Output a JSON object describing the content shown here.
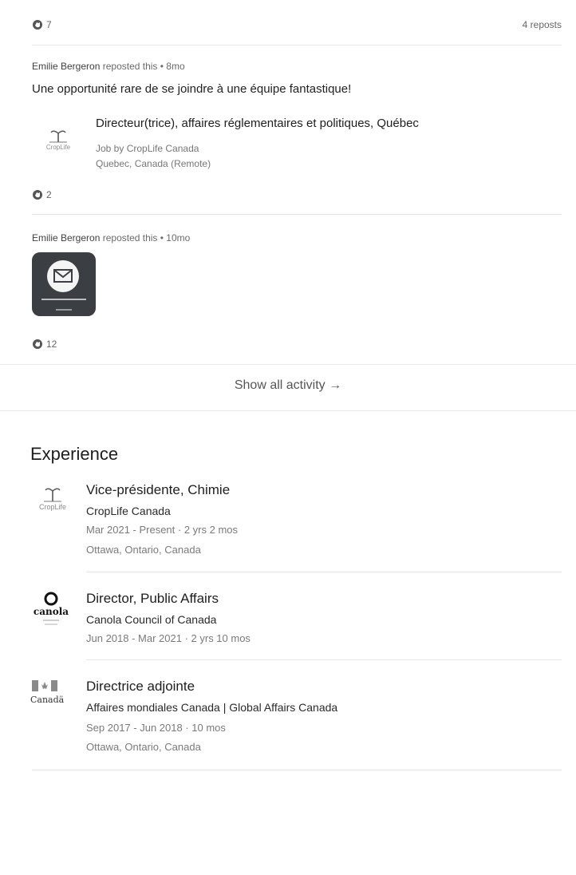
{
  "activity": {
    "top_reactions": "7",
    "reposts_count": "4 reposts",
    "posts": [
      {
        "reposter": "Emilie Bergeron",
        "action": "reposted this • 8mo",
        "text": "Une opportunité rare de se joindre à une équipe fantastique!",
        "job": {
          "title": "Directeur(trice), affaires réglementaires et politiques, Québec",
          "company_line": "Job by CropLife Canada",
          "location": "Quebec, Canada (Remote)",
          "logo_text": "CropLife"
        },
        "reactions": "2"
      },
      {
        "reposter": "Emilie Bergeron",
        "action": "reposted this • 10mo",
        "thumbnail_icon": "envelope-icon",
        "reactions": "12"
      }
    ],
    "show_all": "Show all activity →"
  },
  "experience": {
    "title": "Experience",
    "items": [
      {
        "role": "Vice-présidente, Chimie",
        "org": "CropLife Canada",
        "dates": "Mar 2021 - Present · 2 yrs 2 mos",
        "location": "Ottawa, Ontario, Canada",
        "logo_text": "CropLife"
      },
      {
        "role": "Director, Public Affairs",
        "org": "Canola Council of Canada",
        "dates": "Jun 2018 - Mar 2021 · 2 yrs 10 mos",
        "logo_text": "canola"
      },
      {
        "role": "Directrice adjointe",
        "org": "Affaires mondiales Canada | Global Affairs Canada",
        "dates": "Sep 2017 - Jun 2018 · 10 mos",
        "location": "Ottawa, Ontario, Canada",
        "logo_text": "Canadä"
      }
    ]
  },
  "colors": {
    "text": "#1f1f1f",
    "muted": "#777777",
    "divider": "#e7e7e7",
    "thumb_bg": "#3b3e43"
  }
}
